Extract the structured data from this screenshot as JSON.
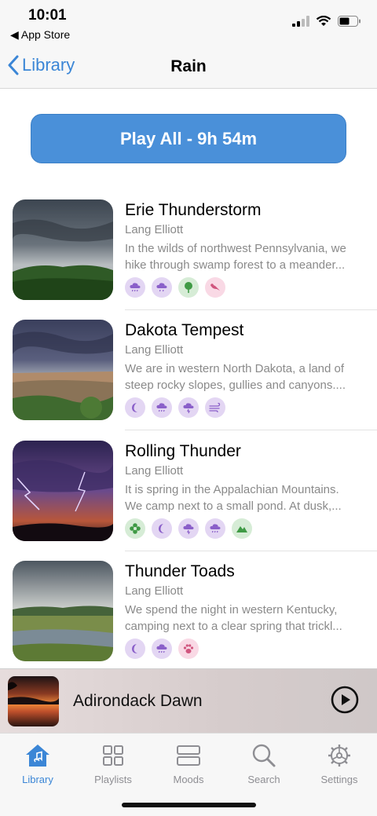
{
  "status": {
    "time": "10:01",
    "back_app": "◀ App Store"
  },
  "navbar": {
    "back_label": "Library",
    "title": "Rain"
  },
  "play_all": {
    "label": "Play All - 9h 54m"
  },
  "tracks": [
    {
      "name": "Erie Thunderstorm",
      "artist": "Lang Elliott",
      "desc_line1": "In the wilds of northwest Pennsylvania, we",
      "desc_line2": "hike through swamp forest to a meander...",
      "tags": [
        "rain-cloud-icon",
        "rain-cloud-icon",
        "tree-icon",
        "bird-icon"
      ]
    },
    {
      "name": "Dakota Tempest",
      "artist": "Lang Elliott",
      "desc_line1": "We are in western North Dakota, a land of",
      "desc_line2": "steep rocky slopes, gullies and canyons....",
      "tags": [
        "moon-icon",
        "rain-cloud-icon",
        "thunder-cloud-icon",
        "wind-icon"
      ]
    },
    {
      "name": "Rolling Thunder",
      "artist": "Lang Elliott",
      "desc_line1": "It is spring in the Appalachian Mountains.",
      "desc_line2": "We camp next to a small pond. At dusk,...",
      "tags": [
        "flower-icon",
        "moon-icon",
        "thunder-cloud-icon",
        "rain-cloud-icon",
        "mountain-icon"
      ]
    },
    {
      "name": "Thunder Toads",
      "artist": "Lang Elliott",
      "desc_line1": "We spend the night in western Kentucky,",
      "desc_line2": "camping next to a clear spring that trickl...",
      "tags": [
        "moon-icon",
        "rain-cloud-icon",
        "paw-icon"
      ]
    }
  ],
  "mini_player": {
    "title": "Adirondack Dawn"
  },
  "tabs": [
    {
      "label": "Library",
      "icon": "library-icon",
      "active": true
    },
    {
      "label": "Playlists",
      "icon": "playlists-icon",
      "active": false
    },
    {
      "label": "Moods",
      "icon": "moods-icon",
      "active": false
    },
    {
      "label": "Search",
      "icon": "search-icon",
      "active": false
    },
    {
      "label": "Settings",
      "icon": "settings-icon",
      "active": false
    }
  ],
  "colors": {
    "accent": "#3b86d6",
    "play_button": "#4a90d9",
    "tag_purple": "#e3d6f3",
    "tag_green": "#d6ecd6",
    "tag_pink": "#f9d9e5"
  }
}
